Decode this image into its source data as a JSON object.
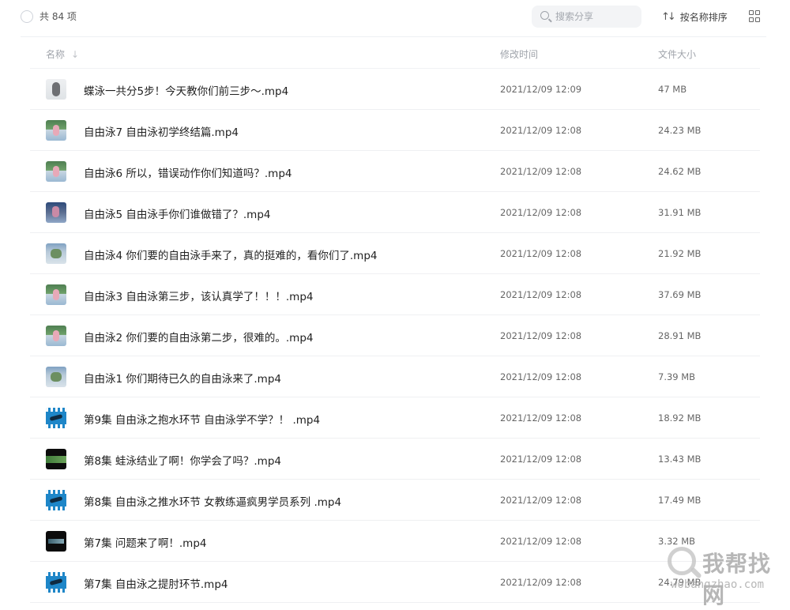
{
  "toolbar": {
    "count_label": "共 84 项",
    "search_placeholder": "搜索分享",
    "sort_label": "按名称排序",
    "sort_icon": "sort-arrows-icon",
    "view_icon": "grid-view-icon"
  },
  "columns": {
    "name": "名称",
    "time": "修改时间",
    "size": "文件大小"
  },
  "files": [
    {
      "name": "蝶泳一共分5步！今天教你们前三步～.mp4",
      "time": "2021/12/09 12:09",
      "size": "47 MB",
      "thumb": "t-white"
    },
    {
      "name": "自由泳7 自由泳初学终结篇.mp4",
      "time": "2021/12/09 12:08",
      "size": "24.23 MB",
      "thumb": "t-pool"
    },
    {
      "name": "自由泳6 所以，错误动作你们知道吗？.mp4",
      "time": "2021/12/09 12:08",
      "size": "24.62 MB",
      "thumb": "t-pool"
    },
    {
      "name": "自由泳5 自由泳手你们谁做错了？.mp4",
      "time": "2021/12/09 12:08",
      "size": "31.91 MB",
      "thumb": "t-pool2"
    },
    {
      "name": "自由泳4 你们要的自由泳手来了，真的挺难的，看你们了.mp4",
      "time": "2021/12/09 12:08",
      "size": "21.92 MB",
      "thumb": "t-outdoor"
    },
    {
      "name": "自由泳3 自由泳第三步，该认真学了！！！.mp4",
      "time": "2021/12/09 12:08",
      "size": "37.69 MB",
      "thumb": "t-pool"
    },
    {
      "name": "自由泳2 你们要的自由泳第二步，很难的。.mp4",
      "time": "2021/12/09 12:08",
      "size": "28.91 MB",
      "thumb": "t-pool"
    },
    {
      "name": "自由泳1 你们期待已久的自由泳来了.mp4",
      "time": "2021/12/09 12:08",
      "size": "7.39 MB",
      "thumb": "t-outdoor"
    },
    {
      "name": "第9集 自由泳之抱水环节 自由泳学不学？！ .mp4",
      "time": "2021/12/09 12:08",
      "size": "18.92 MB",
      "thumb": "t-video"
    },
    {
      "name": "第8集 蛙泳结业了啊！你学会了吗？.mp4",
      "time": "2021/12/09 12:08",
      "size": "13.43 MB",
      "thumb": "t-dark"
    },
    {
      "name": "第8集 自由泳之推水环节 女教练逼疯男学员系列 .mp4",
      "time": "2021/12/09 12:08",
      "size": "17.49 MB",
      "thumb": "t-video"
    },
    {
      "name": "第7集 问题来了啊！.mp4",
      "time": "2021/12/09 12:08",
      "size": "3.32 MB",
      "thumb": "t-dark2"
    },
    {
      "name": "第7集 自由泳之提肘环节.mp4",
      "time": "2021/12/09 12:08",
      "size": "24.79 MB",
      "thumb": "t-video"
    }
  ],
  "watermark": {
    "text": "我帮找网",
    "url": "wobangzhao.com"
  }
}
